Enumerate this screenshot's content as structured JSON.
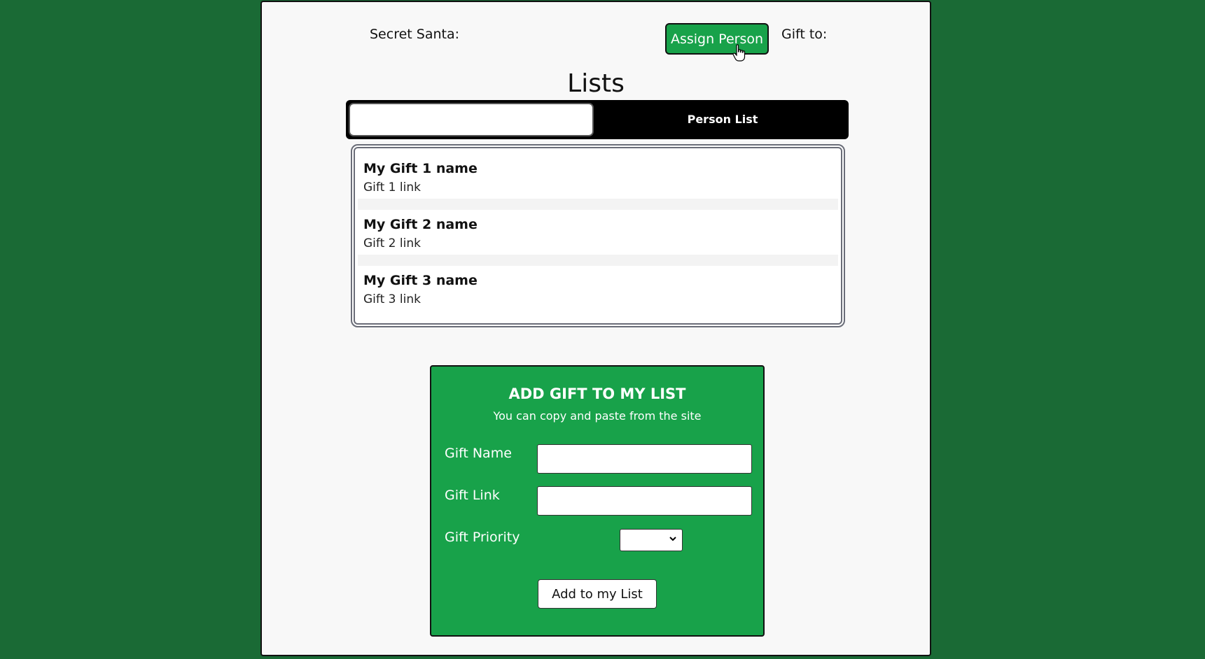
{
  "header": {
    "secret_santa_label": "Secret Santa:",
    "assign_button_label": "Assign Person",
    "gift_to_label": "Gift to:"
  },
  "lists": {
    "title": "Lists",
    "search_value": "",
    "person_list_tab": "Person List",
    "gifts": [
      {
        "name": "My Gift 1 name",
        "link": "Gift 1 link"
      },
      {
        "name": "My Gift 2 name",
        "link": "Gift 2 link"
      },
      {
        "name": "My Gift 3 name",
        "link": "Gift 3 link"
      }
    ]
  },
  "add_form": {
    "title": "ADD GIFT TO MY LIST",
    "subtitle": "You can copy and paste from the site",
    "gift_name_label": "Gift Name",
    "gift_name_value": "",
    "gift_link_label": "Gift Link",
    "gift_link_value": "",
    "gift_priority_label": "Gift Priority",
    "gift_priority_value": "",
    "submit_label": "Add to my List"
  },
  "colors": {
    "background": "#1a6a35",
    "accent_green": "#18a24a",
    "page": "#f8f8f8"
  }
}
